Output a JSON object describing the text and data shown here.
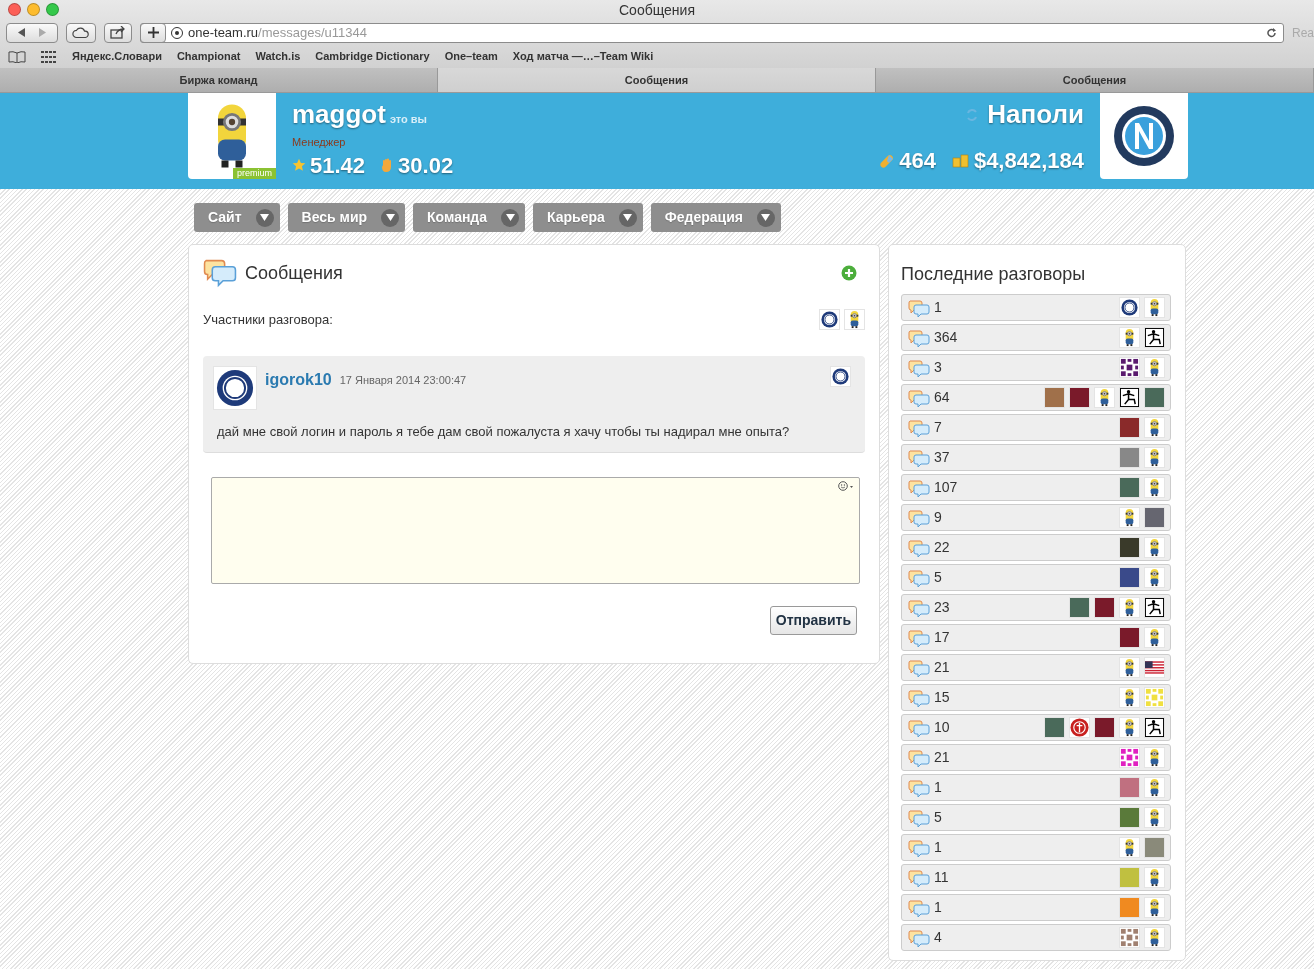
{
  "browser": {
    "title": "Сообщения",
    "address_host": "one-team.ru",
    "address_path": "/messages/u11344",
    "reader": "Rea",
    "bookmarks": [
      "Яндекс.Словари",
      "Championat",
      "Watch.is",
      "Cambridge Dictionary",
      "One–team",
      "Ход матча —…–Team Wiki"
    ],
    "tabs": [
      {
        "label": "Биржа команд",
        "selected": false
      },
      {
        "label": "Сообщения",
        "selected": true
      },
      {
        "label": "Сообщения",
        "selected": false
      }
    ]
  },
  "profile": {
    "username": "maggot",
    "you_label": "это вы",
    "role": "Менеджер",
    "badge": "premium",
    "rating": "51.42",
    "power": "30.02"
  },
  "team": {
    "name": "Наполи",
    "pills": "464",
    "money": "$4,842,184"
  },
  "menu": [
    "Сайт",
    "Весь мир",
    "Команда",
    "Карьера",
    "Федерация"
  ],
  "messages": {
    "title": "Сообщения",
    "participants_label": "Участники разговора:",
    "participants": [
      {
        "kind": "crest"
      },
      {
        "kind": "figure"
      }
    ],
    "message": {
      "author": "igorok10",
      "date": "17 Января 2014 23:00:47",
      "text": "дай мне свой логин и пароль я тебе дам свой пожалуста я хачу чтобы ты надирал мне опыта?"
    },
    "send_button": "Отправить"
  },
  "recent": {
    "title": "Последние разговоры",
    "conversations": [
      {
        "count": "1",
        "avatars": [
          {
            "kind": "crest"
          },
          {
            "kind": "figure"
          }
        ]
      },
      {
        "count": "364",
        "avatars": [
          {
            "kind": "figure"
          },
          {
            "kind": "kicker"
          }
        ]
      },
      {
        "count": "3",
        "avatars": [
          {
            "kind": "pattern",
            "color": "#5a1a6e"
          },
          {
            "kind": "figure"
          }
        ]
      },
      {
        "count": "64",
        "avatars": [
          {
            "kind": "photo",
            "color": "#a0704a"
          },
          {
            "kind": "photo",
            "color": "#7a1a2a"
          },
          {
            "kind": "figure"
          },
          {
            "kind": "kicker"
          },
          {
            "kind": "photo",
            "color": "#4a6a5a"
          }
        ]
      },
      {
        "count": "7",
        "avatars": [
          {
            "kind": "photo",
            "color": "#8a2a2a"
          },
          {
            "kind": "figure"
          }
        ]
      },
      {
        "count": "37",
        "avatars": [
          {
            "kind": "photo",
            "color": "#888888"
          },
          {
            "kind": "figure"
          }
        ]
      },
      {
        "count": "107",
        "avatars": [
          {
            "kind": "photo",
            "color": "#4a6a5a"
          },
          {
            "kind": "figure"
          }
        ]
      },
      {
        "count": "9",
        "avatars": [
          {
            "kind": "figure"
          },
          {
            "kind": "photo",
            "color": "#666670"
          }
        ]
      },
      {
        "count": "22",
        "avatars": [
          {
            "kind": "photo",
            "color": "#3a3a2a"
          },
          {
            "kind": "figure"
          }
        ]
      },
      {
        "count": "5",
        "avatars": [
          {
            "kind": "photo",
            "color": "#3a4a8a"
          },
          {
            "kind": "figure"
          }
        ]
      },
      {
        "count": "23",
        "avatars": [
          {
            "kind": "photo",
            "color": "#4a6a5a"
          },
          {
            "kind": "photo",
            "color": "#7a1a2a"
          },
          {
            "kind": "figure"
          },
          {
            "kind": "kicker"
          }
        ]
      },
      {
        "count": "17",
        "avatars": [
          {
            "kind": "photo",
            "color": "#7a1a2a"
          },
          {
            "kind": "figure"
          }
        ]
      },
      {
        "count": "21",
        "avatars": [
          {
            "kind": "figure"
          },
          {
            "kind": "flag"
          }
        ]
      },
      {
        "count": "15",
        "avatars": [
          {
            "kind": "figure"
          },
          {
            "kind": "pattern",
            "color": "#f0e040"
          }
        ]
      },
      {
        "count": "10",
        "avatars": [
          {
            "kind": "photo",
            "color": "#4a6a5a"
          },
          {
            "kind": "emblem"
          },
          {
            "kind": "photo",
            "color": "#7a1a2a"
          },
          {
            "kind": "figure"
          },
          {
            "kind": "kicker"
          }
        ]
      },
      {
        "count": "21",
        "avatars": [
          {
            "kind": "pattern",
            "color": "#e020c0"
          },
          {
            "kind": "figure"
          }
        ]
      },
      {
        "count": "1",
        "avatars": [
          {
            "kind": "photo",
            "color": "#c07080"
          },
          {
            "kind": "figure"
          }
        ]
      },
      {
        "count": "5",
        "avatars": [
          {
            "kind": "photo",
            "color": "#5a7a3a"
          },
          {
            "kind": "figure"
          }
        ]
      },
      {
        "count": "1",
        "avatars": [
          {
            "kind": "figure"
          },
          {
            "kind": "photo",
            "color": "#8a8a7a"
          }
        ]
      },
      {
        "count": "11",
        "avatars": [
          {
            "kind": "photo",
            "color": "#c0c040"
          },
          {
            "kind": "figure"
          }
        ]
      },
      {
        "count": "1",
        "avatars": [
          {
            "kind": "photo",
            "color": "#f08a20"
          },
          {
            "kind": "figure"
          }
        ]
      },
      {
        "count": "4",
        "avatars": [
          {
            "kind": "pattern",
            "color": "#a08070"
          },
          {
            "kind": "figure"
          }
        ]
      }
    ]
  }
}
